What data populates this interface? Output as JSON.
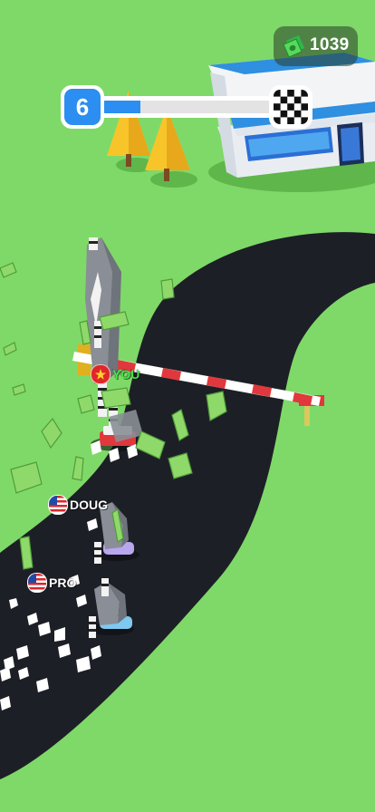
{
  "hud": {
    "cash": "1039",
    "cash_icon": "money-stack-icon",
    "level": "6",
    "level_progress": 0.22,
    "finish_icon": "checkered-flag-icon"
  },
  "racers": [
    {
      "name": "YOU",
      "flag": "vietnam-flag-icon",
      "color": "#46e34a"
    },
    {
      "name": "DOUG",
      "flag": "usa-flag-icon",
      "color": "#ffffff"
    },
    {
      "name": "PRO",
      "flag": "usa-flag-icon",
      "color": "#ffffff"
    }
  ],
  "colors": {
    "grass": "#7fd968",
    "road": "#1d1f26",
    "player_tag": "#46e34a",
    "level_blue": "#2b8ef0",
    "barrier_red": "#e0383c"
  }
}
